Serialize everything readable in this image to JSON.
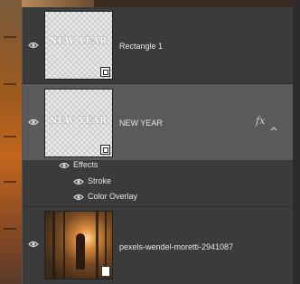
{
  "layers": [
    {
      "name": "Rectangle 1",
      "thumb_text": "NEW YEAR",
      "visible": true,
      "selected": false
    },
    {
      "name": "NEW YEAR",
      "thumb_text": "NEW YEAR",
      "visible": true,
      "selected": true,
      "fx_label": "fx"
    },
    {
      "name": "pexels-wendel-moretti-2941087",
      "visible": true,
      "selected": false
    }
  ],
  "effects": {
    "header": "Effects",
    "items": [
      "Stroke",
      "Color Overlay"
    ]
  },
  "colors": {
    "panel_bg": "#3b3b3b",
    "selected_row": "#5a5a5a",
    "text": "#e8e8e8"
  },
  "icons": [
    "eye-icon",
    "fx-icon",
    "chevron-up-icon",
    "smart-object-icon",
    "document-icon"
  ]
}
